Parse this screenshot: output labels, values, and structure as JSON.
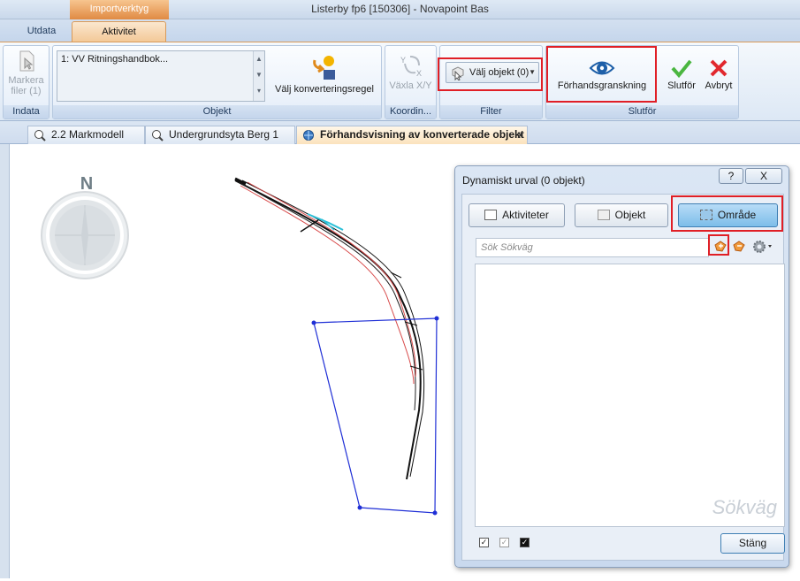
{
  "window": {
    "title": "Listerby fp6 [150306] - Novapoint Bas",
    "context_tab": "Importverktyg"
  },
  "ribbon_tabs": [
    {
      "label": "Utdata",
      "active": false
    },
    {
      "label": "Aktivitet",
      "active": true
    }
  ],
  "ribbon": {
    "indata": {
      "group_label": "Indata",
      "mark_files_label_line1": "Markera",
      "mark_files_label_line2": "filer (1)"
    },
    "objekt": {
      "group_label": "Objekt",
      "list_item": "1: VV Ritningshandbok...",
      "conversion_rule_label": "Välj konverteringsregel"
    },
    "koordinat": {
      "group_label": "Koordin...",
      "swap_xy_label": "Växla X/Y"
    },
    "filter": {
      "group_label": "Filter",
      "select_objects_label": "Välj objekt (0)"
    },
    "slutfor": {
      "group_label": "Slutför",
      "preview_label": "Förhandsgranskning",
      "finish_label": "Slutför",
      "cancel_label": "Avbryt"
    }
  },
  "doc_tabs": [
    {
      "label": "2.2 Markmodell",
      "active": false
    },
    {
      "label": "Undergrundsyta Berg 1",
      "active": false
    },
    {
      "label": "Förhandsvisning av konverterade objekt",
      "active": true,
      "close": "x"
    }
  ],
  "compass": {
    "label": "N"
  },
  "dialog": {
    "title": "Dynamiskt urval (0 objekt)",
    "help_label": "?",
    "close_label": "X",
    "buttons": {
      "aktiviteter": "Aktiviteter",
      "objekt": "Objekt",
      "omrade": "Område"
    },
    "search_placeholder": "Sök Sökväg",
    "watermark": "Sökväg",
    "close_button": "Stäng"
  },
  "colors": {
    "highlight_red": "#e01f26",
    "area_polygon": "#1f2fd6",
    "context_orange": "#e08a43",
    "selected_blue": "#7cbde9"
  }
}
